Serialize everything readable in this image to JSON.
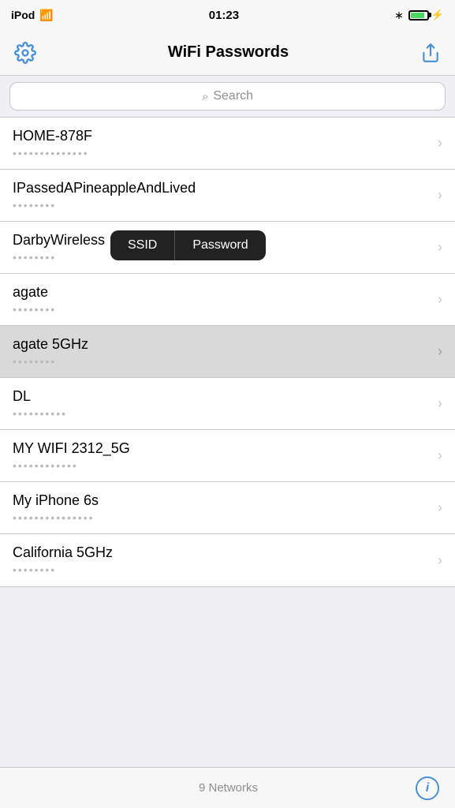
{
  "statusBar": {
    "carrier": "iPod",
    "time": "01:23",
    "bluetooth": "✱",
    "battery": 85
  },
  "navBar": {
    "title": "WiFi Passwords",
    "gearLabel": "Settings",
    "shareLabel": "Share"
  },
  "search": {
    "placeholder": "Search"
  },
  "networks": [
    {
      "id": 1,
      "ssid": "HOME-878F",
      "password_hint": "••••••••••••••"
    },
    {
      "id": 2,
      "ssid": "IPassedAPineappleAndLived",
      "password_hint": "••••••••"
    },
    {
      "id": 3,
      "ssid": "DarbyWireless",
      "password_hint": "••••••••"
    },
    {
      "id": 4,
      "ssid": "agate",
      "password_hint": "••••••••",
      "showTooltip": true
    },
    {
      "id": 5,
      "ssid": "agate 5GHz",
      "password_hint": "••••••••",
      "selected": true
    },
    {
      "id": 6,
      "ssid": "DL",
      "password_hint": "••••••••••"
    },
    {
      "id": 7,
      "ssid": "MY WIFI 2312_5G",
      "password_hint": "••••••••••••"
    },
    {
      "id": 8,
      "ssid": "My iPhone 6s",
      "password_hint": "•••••••••••••••"
    },
    {
      "id": 9,
      "ssid": "California 5GHz",
      "password_hint": "••••••••"
    }
  ],
  "tooltip": {
    "ssidLabel": "SSID",
    "passwordLabel": "Password"
  },
  "footer": {
    "networkCount": "9 Networks",
    "infoLabel": "i"
  }
}
